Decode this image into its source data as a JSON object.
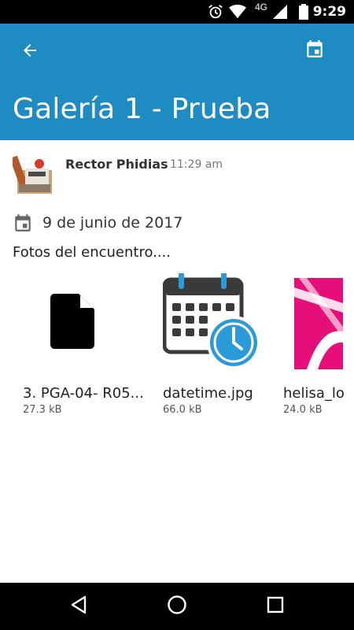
{
  "status_bar": {
    "time": "9:29",
    "network_label": "4G",
    "icons": [
      "alarm-icon",
      "wifi-icon",
      "signal-icon",
      "battery-icon"
    ]
  },
  "app_bar": {
    "title": "Galería 1 - Prueba",
    "back_icon": "arrow-back-icon",
    "action_icon": "calendar-icon",
    "color": "#1e8bc3"
  },
  "post": {
    "author": "Rector Phidias",
    "time": "11:29 am",
    "date": "9 de junio de 2017",
    "description": "Fotos del encuentro...."
  },
  "files": [
    {
      "name": "3. PGA-04- R05...",
      "size": "27.3 kB",
      "thumbnail": "document-icon"
    },
    {
      "name": "datetime.jpg",
      "size": "66.0 kB",
      "thumbnail": "datetime-calendar-clock-image"
    },
    {
      "name": "helisa_lo",
      "size": "24.0 kB",
      "thumbnail": "helisa-logo-image"
    }
  ],
  "nav_bar": {
    "icons": [
      "back-triangle-icon",
      "home-circle-icon",
      "recents-square-icon"
    ]
  }
}
